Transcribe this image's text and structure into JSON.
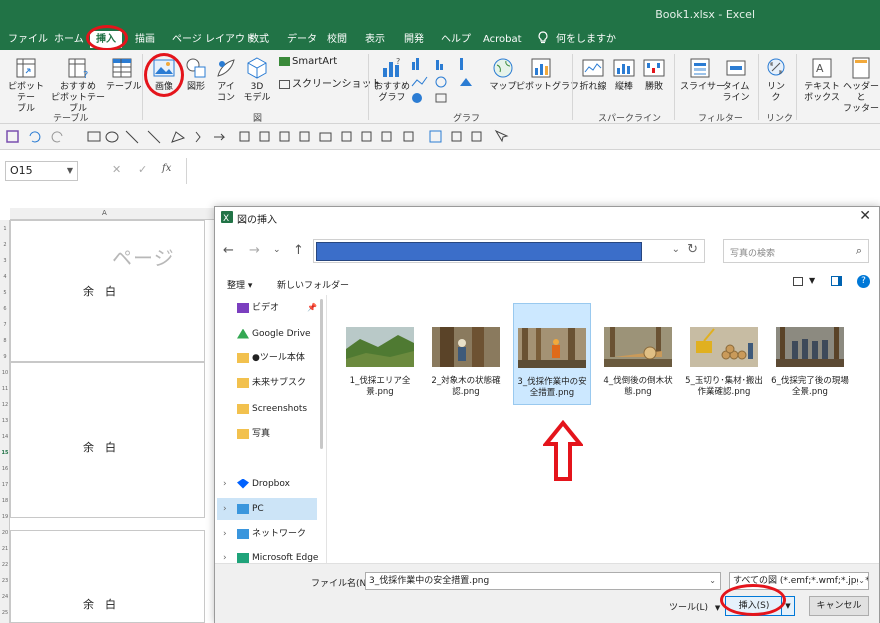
{
  "window": {
    "title": "Book1.xlsx  -  Excel"
  },
  "menu": {
    "tabs": [
      "ファイル",
      "ホーム",
      "挿入",
      "描画",
      "ページ レイアウト",
      "数式",
      "データ",
      "校閲",
      "表示",
      "開発",
      "ヘルプ",
      "Acrobat"
    ],
    "active_tab": "挿入",
    "tell_me": "何をしますか"
  },
  "ribbon": {
    "table_group": {
      "label": "テーブル",
      "pivot": "ピボットテー\nブル",
      "recommended_pivot": "おすすめ\nピボットテーブル",
      "table": "テーブル"
    },
    "illust_group": {
      "label": "図",
      "image": "画像",
      "shapes": "図形",
      "icons": "アイ\nコン",
      "models3d": "3D\nモデル",
      "smartart": "SmartArt",
      "screenshot": "スクリーンショット"
    },
    "graph_group": {
      "label": "グラフ",
      "recommended_chart": "おすすめ\nグラフ",
      "map": "マップ",
      "pivotchart": "ピボットグラフ"
    },
    "sparkline_group": {
      "label": "スパークライン",
      "line": "折れ線",
      "column": "縦棒",
      "winloss": "勝敗"
    },
    "filter_group": {
      "label": "フィルター",
      "slicer": "スライサー",
      "timeline": "タイム\nライン"
    },
    "link_group": {
      "label": "リンク",
      "link": "リン\nク"
    },
    "text_group": {
      "textbox": "テキスト\nボックス",
      "header_footer": "ヘッダーと\nフッター"
    }
  },
  "formula_bar": {
    "name_box": "O15"
  },
  "sheet": {
    "col_header": "A",
    "row_numbers": [
      "1",
      "2",
      "3",
      "4",
      "5",
      "6",
      "7",
      "8",
      "9",
      "10",
      "11",
      "12",
      "13",
      "14",
      "15",
      "16",
      "17",
      "18",
      "19",
      "20",
      "21",
      "22",
      "23",
      "24",
      "25"
    ],
    "margin_label": "余　白",
    "page_watermark": "ページ"
  },
  "dialog": {
    "title": "図の挿入",
    "search_placeholder": "写真の検索",
    "organize": "整理 ▾",
    "new_folder": "新しいフォルダー",
    "nav_items": [
      {
        "label": "ビデオ",
        "icon": "video-folder-icon",
        "color": "#7b3fbf"
      },
      {
        "label": "Google Drive",
        "icon": "google-drive-icon",
        "color": "#34a853"
      },
      {
        "label": "●ツール本体",
        "icon": "folder-icon",
        "color": "#f2c14e"
      },
      {
        "label": "未来サブスク",
        "icon": "folder-icon",
        "color": "#f2c14e"
      },
      {
        "label": "Screenshots",
        "icon": "folder-icon",
        "color": "#f2c14e"
      },
      {
        "label": "写真",
        "icon": "folder-icon",
        "color": "#f2c14e"
      },
      {
        "label": "Dropbox",
        "icon": "dropbox-icon",
        "color": "#0061fe"
      },
      {
        "label": "PC",
        "icon": "pc-icon",
        "color": "#3a96dd"
      },
      {
        "label": "ネットワーク",
        "icon": "network-icon",
        "color": "#3a96dd"
      },
      {
        "label": "Microsoft Edge",
        "icon": "edge-icon",
        "color": "#1fa37a"
      }
    ],
    "files": [
      {
        "name": "1_伐採エリア全景.png",
        "sky": "#b9c9c8",
        "ground": "#5a7a3a"
      },
      {
        "name": "2_対象木の状態確認.png",
        "sky": "#8a7a5e",
        "ground": "#4a3b2a"
      },
      {
        "name": "3_伐採作業中の安全措置.png",
        "sky": "#a49274",
        "ground": "#5b4c35"
      },
      {
        "name": "4_伐倒後の倒木状態.png",
        "sky": "#9c9378",
        "ground": "#6a5a3e"
      },
      {
        "name": "5_玉切り･集材･搬出作業確認.png",
        "sky": "#c7bca3",
        "ground": "#6d5a3a"
      },
      {
        "name": "6_伐採完了後の現場全景.png",
        "sky": "#8c8a80",
        "ground": "#5c4a34"
      }
    ],
    "filename_label": "ファイル名(N):",
    "filename_value": "3_伐採作業中の安全措置.png",
    "filter_value": "すべての図 (*.emf;*.wmf;*.jpg;*.jp",
    "tools": "ツール(L)",
    "insert": "挿入(S)",
    "cancel": "キャンセル"
  },
  "colors": {
    "excel_green": "#217346",
    "selection_blue": "#cce8ff",
    "annotation_red": "#e4141b"
  }
}
